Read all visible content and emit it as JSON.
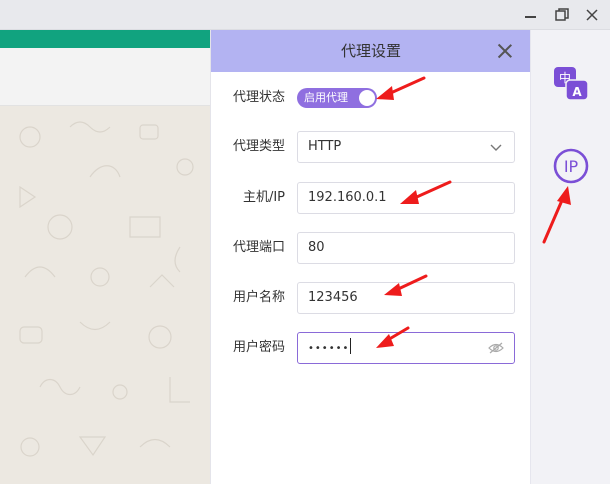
{
  "window": {
    "minimize_icon": "minimize-icon",
    "maximize_icon": "restore-icon",
    "close_icon": "close-icon"
  },
  "colors": {
    "accent": "#8f6fe0",
    "panel_header": "#b3b3f2",
    "app_green": "#11a37f",
    "rail_icon": "#7b4fd6",
    "annotation_red": "#ee1c1c"
  },
  "panel": {
    "title": "代理设置",
    "fields": {
      "status": {
        "label": "代理状态",
        "toggle_text": "启用代理",
        "enabled": true
      },
      "type": {
        "label": "代理类型",
        "value": "HTTP"
      },
      "host": {
        "label": "主机/IP",
        "value": "192.160.0.1"
      },
      "port": {
        "label": "代理端口",
        "value": "80"
      },
      "username": {
        "label": "用户名称",
        "value": "123456"
      },
      "password": {
        "label": "用户密码",
        "value": "••••••"
      }
    }
  },
  "rail": {
    "translate": {
      "glyph_top": "中",
      "glyph_bottom": "A"
    },
    "ip": {
      "text": "IP"
    }
  }
}
